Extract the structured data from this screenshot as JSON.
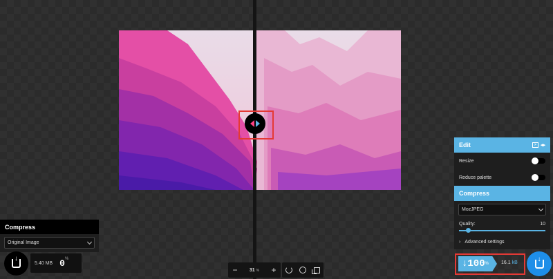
{
  "colors": {
    "accent": "#5ab4e4",
    "highlight_box": "#e53935",
    "download_right": "#1e8ee8"
  },
  "left_panel": {
    "header": "Compress",
    "method": "Original Image",
    "size": "5.40 MB",
    "percent": "0",
    "percent_symbol": "%",
    "download_icon": "download-icon"
  },
  "toolbar": {
    "zoom_out": "−",
    "zoom_value": "31",
    "zoom_unit": "%",
    "zoom_in": "+",
    "icons": [
      "rotate-icon",
      "background-toggle-icon",
      "side-by-side-icon"
    ]
  },
  "right_panel": {
    "edit_header": "Edit",
    "resize_label": "Resize",
    "resize_on": false,
    "reduce_palette_label": "Reduce palette",
    "reduce_palette_on": false,
    "compress_header": "Compress",
    "method": "MozJPEG",
    "quality_label": "Quality:",
    "quality_value": "10",
    "quality_fraction": 0.1,
    "advanced_label": "Advanced settings"
  },
  "result": {
    "arrow": "↓",
    "percent": "100",
    "percent_symbol": "%",
    "size_value": "16.1",
    "size_unit": "kB"
  }
}
